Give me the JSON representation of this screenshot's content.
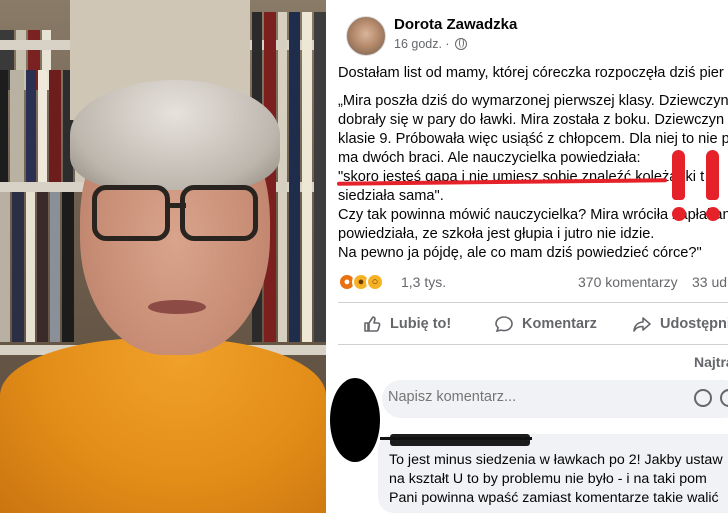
{
  "post": {
    "author": "Dorota Zawadzka",
    "time": "16 godz. ·",
    "lines": [
      "Dostałam list od mamy, której córeczka rozpoczęła dziś pier",
      "„Mira poszła dziś do wymarzonej pierwszej klasy. Dziewczyn",
      "dobrały się w pary do ławki. Mira została z boku. Dziewczyn",
      "klasie 9. Próbowała więc usiąść z chłopcem. Dla niej to nie p",
      "ma dwóch braci. Ale nauczycielka powiedziała:",
      "\"skoro jesteś gapa i nie umiesz sobie znaleźć koleżanki t",
      "siedziała sama\".",
      "Czy tak powinna mówić nauczycielka? Mira wróciła zapłakan",
      "powiedziała, ze szkoła jest głupia i jutro nie idzie.",
      "Na pewno ja pójdę, ale co mam dziś powiedzieć córce?\""
    ],
    "reactions_count": "1,3 tys.",
    "comments_count": "370 komentarzy",
    "shares_count": "33 ud",
    "like_label": "Lubię to!",
    "comment_label": "Komentarz",
    "share_label": "Udostępni",
    "sort_label": "Najtra",
    "comment_placeholder": "Napisz komentarz..."
  },
  "comment": {
    "lines": [
      "To jest minus siedzenia w ławkach po 2! Jakby ustaw",
      "na kształt U to by problemu nie było - i na taki pom",
      "Pani powinna wpaść zamiast komentarze takie walić"
    ]
  },
  "icons": [
    "globe-icon",
    "like-icon",
    "comment-icon",
    "share-icon",
    "angry-emoji-icon",
    "sad-emoji-icon",
    "wow-emoji-icon"
  ],
  "colors": {
    "annotation": "#e5212a",
    "muted": "#65676b",
    "input_bg": "#f0f2f5"
  }
}
